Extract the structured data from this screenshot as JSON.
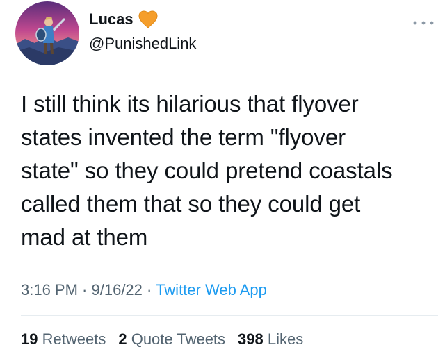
{
  "author": {
    "display_name": "Lucas",
    "handle": "@PunishedLink",
    "badge_icon": "orange-heart-icon",
    "badge_color": "#f59e2b"
  },
  "more_icon": "ellipsis-icon",
  "tweet": {
    "line1": "I still think its hilarious that flyover",
    "line2": "states invented the term \"flyover",
    "line3": "state\" so they could pretend coastals",
    "line4": "called them that so they could get",
    "line5": "mad at them"
  },
  "meta": {
    "time": "3:16 PM",
    "separator1": " · ",
    "date": "9/16/22",
    "separator2": " · ",
    "source": "Twitter Web App"
  },
  "stats": {
    "retweets_count": "19",
    "retweets_label": "Retweets",
    "quotes_count": "2",
    "quotes_label": "Quote Tweets",
    "likes_count": "398",
    "likes_label": "Likes"
  },
  "colors": {
    "text": "#0f1419",
    "secondary": "#536471",
    "link": "#1d9bf0",
    "divider": "#e6ecf0"
  }
}
